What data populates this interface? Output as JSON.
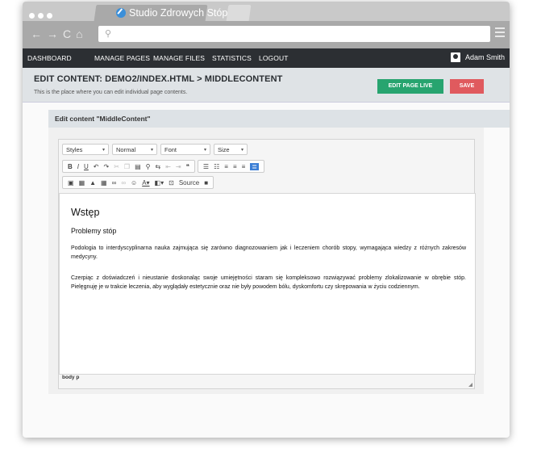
{
  "browser": {
    "tab_title": "Studio Zdrowych Stóp",
    "tab_close": "×"
  },
  "nav": {
    "items": [
      "DASHBOARD",
      "MANAGE PAGES",
      "MANAGE FILES",
      "STATISTICS",
      "LOGOUT"
    ],
    "user_name": "Adam Smith"
  },
  "header": {
    "title": "EDIT CONTENT: DEMO2/INDEX.HTML > MIDDLECONTENT",
    "subtitle": "This is the place where you can edit individual page contents.",
    "edit_live_label": "EDIT PAGE LIVE",
    "save_label": "SAVE"
  },
  "panel": {
    "title": "Edit content \"MiddleContent\""
  },
  "editor": {
    "combos": {
      "styles": "Styles",
      "format": "Normal",
      "font": "Font",
      "size": "Size"
    },
    "source_label": "Source",
    "statusbar": "body  p"
  },
  "document": {
    "heading": "Wstęp",
    "subheading": "Problemy stóp",
    "paragraph1": "Podologia to interdyscyplinarna nauka zajmująca się zarówno diagnozowaniem jak i leczeniem chorób stopy, wymagająca wiedzy z różnych zakresów medycyny.",
    "paragraph2": "Czerpiąc z doświadczeń i nieustanie doskonaląc swoje umiejętności staram się kompleksowo rozwiązywać problemy zlokalizowanie w obrębie stóp. Pielęgnuję je w trakcie leczenia, aby wyglądały estetycznie oraz nie były powodem bólu, dyskomfortu czy skrępowania w życiu codziennym."
  },
  "colors": {
    "nav_bg": "#2c2f33",
    "edit_live": "#27a46f",
    "save": "#e05a5e",
    "header_bg": "#dfe3e6"
  }
}
